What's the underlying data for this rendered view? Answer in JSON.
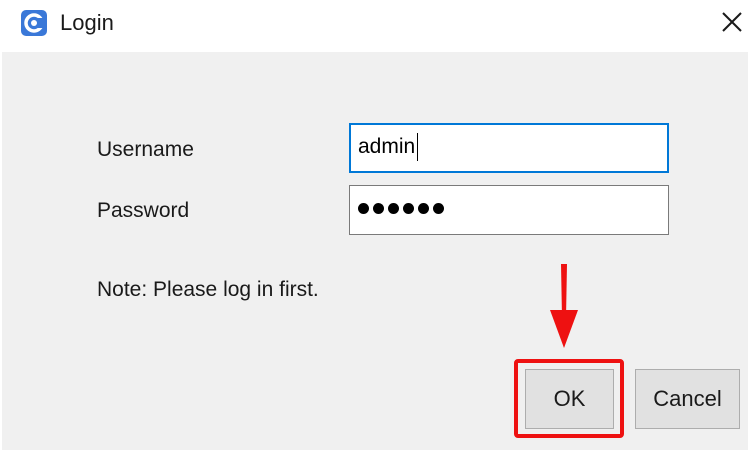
{
  "window": {
    "title": "Login",
    "icon": "app-logo-icon",
    "close_icon": "close-icon"
  },
  "form": {
    "username_label": "Username",
    "username_value": "admin",
    "password_label": "Password",
    "password_mask_count": 6,
    "note": "Note: Please log in first."
  },
  "buttons": {
    "ok_label": "OK",
    "cancel_label": "Cancel"
  },
  "annotation": {
    "highlight_color": "#ee1111",
    "arrow_icon": "arrow-down-icon",
    "target": "ok-button"
  }
}
